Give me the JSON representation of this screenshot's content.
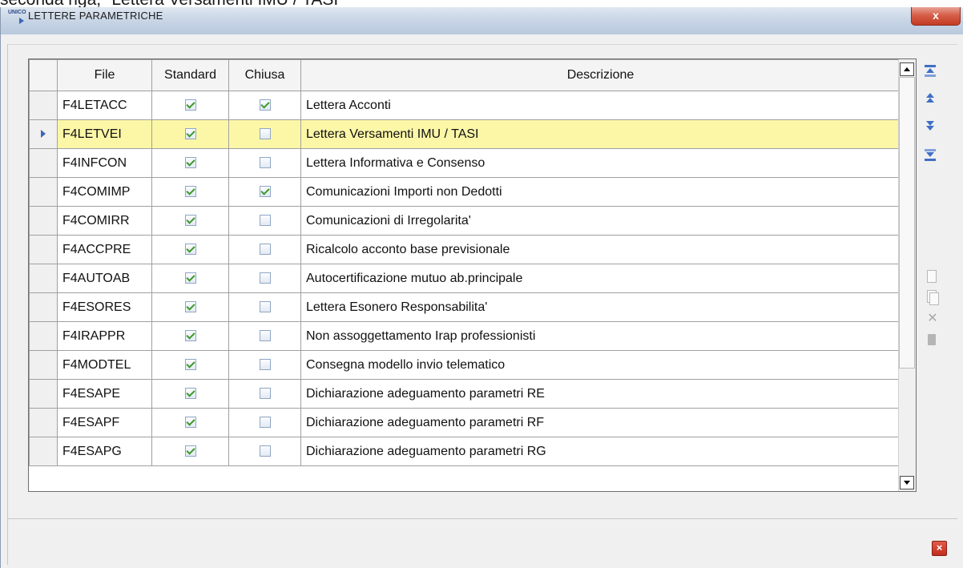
{
  "caption_text": "seconda riga, \"Lettera Versamenti IMU / TASI\"",
  "window": {
    "title": "LETTERE PARAMETRICHE",
    "app_icon_text": "UNICO",
    "close_label": "x"
  },
  "grid": {
    "columns": [
      "File",
      "Standard",
      "Chiusa",
      "Descrizione"
    ],
    "selected_row_index": 1,
    "rows": [
      {
        "file": "F4LETACC",
        "standard": true,
        "chiusa": true,
        "descrizione": "Lettera Acconti"
      },
      {
        "file": "F4LETVEI",
        "standard": true,
        "chiusa": false,
        "descrizione": "Lettera Versamenti IMU / TASI"
      },
      {
        "file": "F4INFCON",
        "standard": true,
        "chiusa": false,
        "descrizione": "Lettera Informativa e Consenso"
      },
      {
        "file": "F4COMIMP",
        "standard": true,
        "chiusa": true,
        "descrizione": "Comunicazioni Importi non Dedotti"
      },
      {
        "file": "F4COMIRR",
        "standard": true,
        "chiusa": false,
        "descrizione": "Comunicazioni di Irregolarita'"
      },
      {
        "file": "F4ACCPRE",
        "standard": true,
        "chiusa": false,
        "descrizione": "Ricalcolo acconto base previsionale"
      },
      {
        "file": "F4AUTOAB",
        "standard": true,
        "chiusa": false,
        "descrizione": "Autocertificazione mutuo ab.principale"
      },
      {
        "file": "F4ESORES",
        "standard": true,
        "chiusa": false,
        "descrizione": "Lettera Esonero Responsabilita'"
      },
      {
        "file": "F4IRAPPR",
        "standard": true,
        "chiusa": false,
        "descrizione": "Non assoggettamento Irap professionisti"
      },
      {
        "file": "F4MODTEL",
        "standard": true,
        "chiusa": false,
        "descrizione": "Consegna modello invio telematico"
      },
      {
        "file": "F4ESAPE",
        "standard": true,
        "chiusa": false,
        "descrizione": "Dichiarazione adeguamento parametri RE"
      },
      {
        "file": "F4ESAPF",
        "standard": true,
        "chiusa": false,
        "descrizione": "Dichiarazione adeguamento parametri RF"
      },
      {
        "file": "F4ESAPG",
        "standard": true,
        "chiusa": false,
        "descrizione": "Dichiarazione adeguamento parametri RG"
      }
    ]
  },
  "side_toolbar": {
    "nav_icons": [
      "first-record-icon",
      "previous-record-icon",
      "next-record-icon",
      "last-record-icon"
    ],
    "action_icons": [
      "new-document-icon",
      "copy-document-icon",
      "delete-icon",
      "clipboard-icon"
    ]
  },
  "footer": {
    "exit_label": "×"
  },
  "colors": {
    "selected_row": "#fcf7a7",
    "check_green": "#3b9a2c",
    "nav_blue": "#3f6fc6",
    "close_red": "#c43a22"
  }
}
